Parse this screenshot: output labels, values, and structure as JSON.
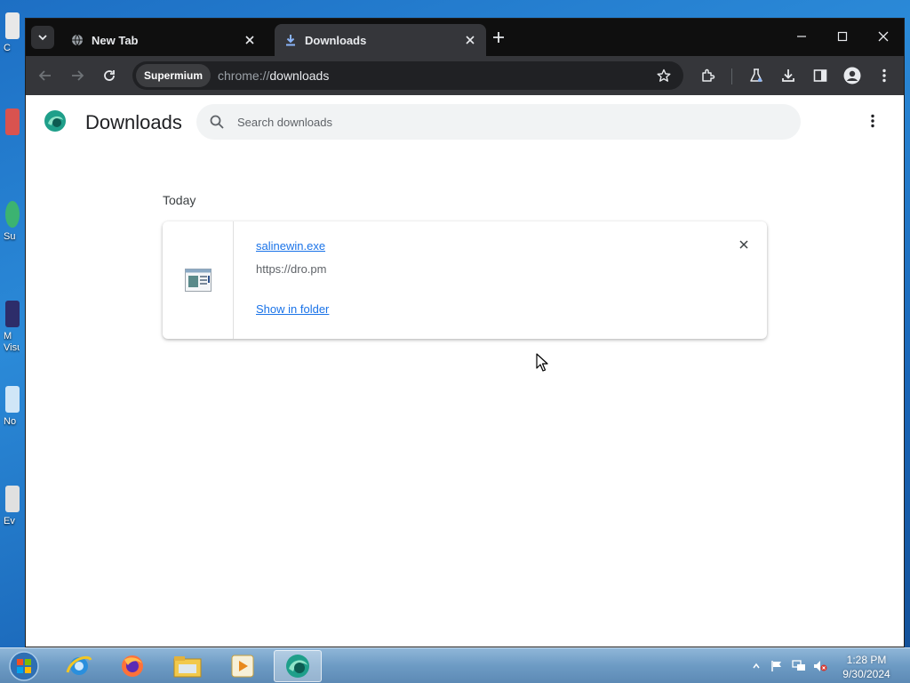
{
  "desktop": {
    "icons": [
      {
        "label": "C",
        "color": "#e8e8e8"
      },
      {
        "label": "",
        "color": "#d9534f"
      },
      {
        "label": "Su",
        "color": "#3cb371"
      },
      {
        "label": "M Visu",
        "color": "#2d2d6a"
      },
      {
        "label": "No",
        "color": "#d0e6f7"
      },
      {
        "label": "Ev",
        "color": "#e0e0e0"
      }
    ]
  },
  "browser": {
    "tabs": [
      {
        "title": "New Tab",
        "icon": "globe-icon",
        "active": false
      },
      {
        "title": "Downloads",
        "icon": "download-icon",
        "active": true
      }
    ],
    "toolbar": {
      "site_chip": "Supermium",
      "url_scheme": "chrome://",
      "url_path": "downloads"
    }
  },
  "page": {
    "title": "Downloads",
    "search": {
      "placeholder": "Search downloads"
    },
    "section_label": "Today",
    "download": {
      "file_name": "salinewin.exe",
      "source_url": "https://dro.pm",
      "action_label": "Show in folder"
    }
  },
  "taskbar": {
    "apps": [
      "internet-explorer-icon",
      "firefox-icon",
      "file-explorer-icon",
      "media-player-icon",
      "supermium-icon"
    ],
    "clock": {
      "time": "1:28 PM",
      "date": "9/30/2024"
    }
  },
  "colors": {
    "link": "#1a73e8",
    "titlebar": "#0f0f0f",
    "toolbar": "#35363a"
  }
}
